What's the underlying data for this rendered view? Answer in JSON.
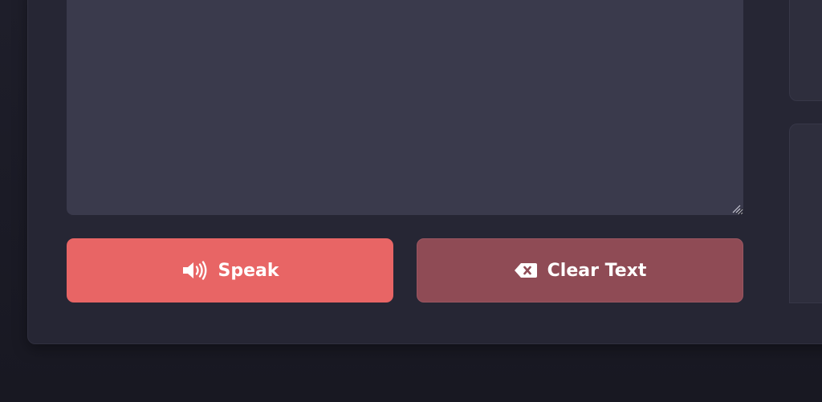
{
  "editor": {
    "value": "",
    "placeholder": ""
  },
  "actions": {
    "speak_label": "Speak",
    "clear_label": "Clear Text"
  },
  "icons": {
    "speak": "volume-up-icon",
    "clear": "backspace-icon"
  },
  "colors": {
    "speak_button": "#e86565",
    "clear_button": "#8f4b55",
    "textarea": "#3a3a4c",
    "panel": "#262634",
    "background": "#1c1c27"
  }
}
